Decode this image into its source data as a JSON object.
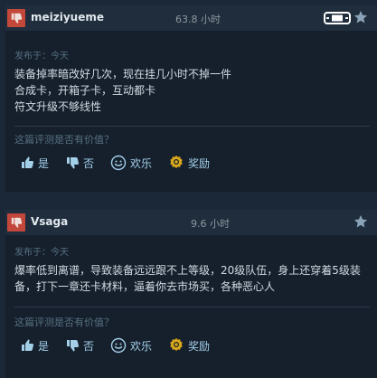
{
  "reviews": [
    {
      "username": "meiziyueme",
      "hours": "63.8 小时",
      "posted": "发布于：今天",
      "lines": [
        "装备掉率暗改好几次，现在挂几小时不掉一件",
        "合成卡，开箱子卡，互动都卡",
        "符文升级不够线性"
      ],
      "helpful_question": "这篇评测是否有价值？",
      "buttons": {
        "yes": "是",
        "no": "否",
        "funny": "欢乐",
        "award": "奖励"
      },
      "recommended": false
    },
    {
      "username": "Vsaga",
      "hours": "9.6 小时",
      "posted": "发布于：今天",
      "lines": [
        "爆率低到离谱，导致装备远远跟不上等级，20级队伍，身上还穿着5级装备，打下一章还卡材料，逼着你去市场买，各种恶心人"
      ],
      "helpful_question": "这篇评测是否有价值？",
      "buttons": {
        "yes": "是",
        "no": "否",
        "funny": "欢乐",
        "award": "奖励"
      },
      "recommended": false
    }
  ],
  "icons": {
    "not_recommended": "thumbs-down-icon",
    "device": "steam-deck-icon",
    "star": "star-icon",
    "yes": "thumbs-up-icon",
    "no": "thumbs-down-icon",
    "funny": "smiley-icon",
    "award": "award-icon"
  },
  "colors": {
    "not_recommended_red": "#c3473a",
    "link_blue": "#a3cfe8",
    "award_gold": "#d8a71b"
  }
}
